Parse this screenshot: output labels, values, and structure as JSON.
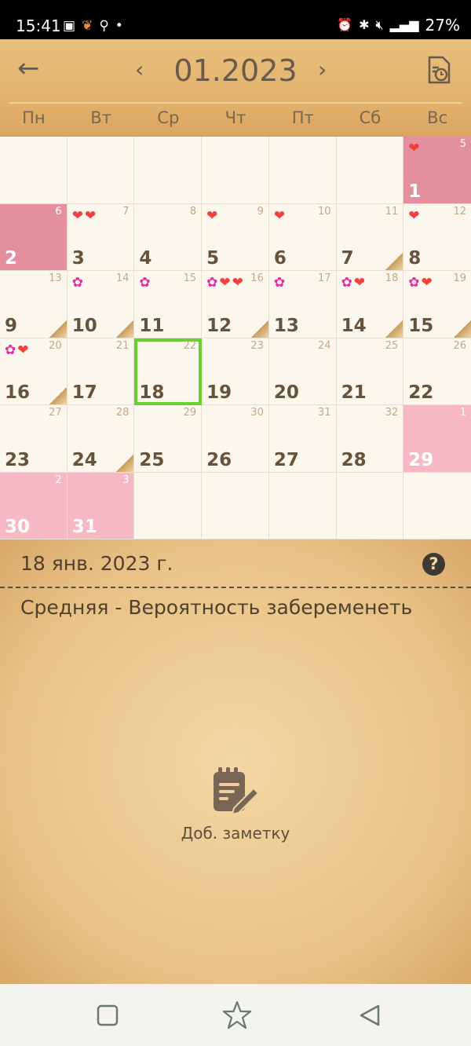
{
  "status_bar": {
    "time": "15:41",
    "left_icons": [
      "gallery-icon",
      "app-icon",
      "search-icon",
      "dot-icon"
    ],
    "right_icons": [
      "alarm-icon",
      "bluetooth-icon",
      "mute-icon",
      "volte-icon",
      "4g-icon",
      "signal-icon"
    ],
    "battery": "27%"
  },
  "header": {
    "month_title": "01.2023",
    "prev_symbol": "‹",
    "next_symbol": "›",
    "back_symbol": "←",
    "weekdays": [
      "Пн",
      "Вт",
      "Ср",
      "Чт",
      "Пт",
      "Сб",
      "Вс"
    ]
  },
  "calendar": {
    "cells": [
      {
        "day": "",
        "cycle": "",
        "state": "",
        "icons": [],
        "note": false
      },
      {
        "day": "",
        "cycle": "",
        "state": "",
        "icons": [],
        "note": false
      },
      {
        "day": "",
        "cycle": "",
        "state": "",
        "icons": [],
        "note": false
      },
      {
        "day": "",
        "cycle": "",
        "state": "",
        "icons": [],
        "note": false
      },
      {
        "day": "",
        "cycle": "",
        "state": "",
        "icons": [],
        "note": false
      },
      {
        "day": "",
        "cycle": "",
        "state": "",
        "icons": [],
        "note": false
      },
      {
        "day": "1",
        "cycle": "5",
        "state": "period-dark",
        "icons": [
          "heart"
        ],
        "note": false
      },
      {
        "day": "2",
        "cycle": "6",
        "state": "period-dark",
        "icons": [],
        "note": false
      },
      {
        "day": "3",
        "cycle": "7",
        "state": "",
        "icons": [
          "heart",
          "pill"
        ],
        "note": false
      },
      {
        "day": "4",
        "cycle": "8",
        "state": "",
        "icons": [],
        "note": false
      },
      {
        "day": "5",
        "cycle": "9",
        "state": "",
        "icons": [
          "heart"
        ],
        "note": false
      },
      {
        "day": "6",
        "cycle": "10",
        "state": "",
        "icons": [
          "heart"
        ],
        "note": false
      },
      {
        "day": "7",
        "cycle": "11",
        "state": "",
        "icons": [],
        "note": true
      },
      {
        "day": "8",
        "cycle": "12",
        "state": "",
        "icons": [
          "heart"
        ],
        "note": false
      },
      {
        "day": "9",
        "cycle": "13",
        "state": "",
        "icons": [],
        "note": true
      },
      {
        "day": "10",
        "cycle": "14",
        "state": "",
        "icons": [
          "flower"
        ],
        "note": true
      },
      {
        "day": "11",
        "cycle": "15",
        "state": "",
        "icons": [
          "flower"
        ],
        "note": false
      },
      {
        "day": "12",
        "cycle": "16",
        "state": "",
        "icons": [
          "flower",
          "heart",
          "pill"
        ],
        "note": true
      },
      {
        "day": "13",
        "cycle": "17",
        "state": "",
        "icons": [
          "flower"
        ],
        "note": false
      },
      {
        "day": "14",
        "cycle": "18",
        "state": "",
        "icons": [
          "flower",
          "heart"
        ],
        "note": true
      },
      {
        "day": "15",
        "cycle": "19",
        "state": "",
        "icons": [
          "flower",
          "heart"
        ],
        "note": true
      },
      {
        "day": "16",
        "cycle": "20",
        "state": "",
        "icons": [
          "flower",
          "heart"
        ],
        "note": true
      },
      {
        "day": "17",
        "cycle": "21",
        "state": "",
        "icons": [],
        "note": false
      },
      {
        "day": "18",
        "cycle": "22",
        "state": "today",
        "icons": [],
        "note": false
      },
      {
        "day": "19",
        "cycle": "23",
        "state": "",
        "icons": [],
        "note": false
      },
      {
        "day": "20",
        "cycle": "24",
        "state": "",
        "icons": [],
        "note": false
      },
      {
        "day": "21",
        "cycle": "25",
        "state": "",
        "icons": [],
        "note": false
      },
      {
        "day": "22",
        "cycle": "26",
        "state": "",
        "icons": [],
        "note": false
      },
      {
        "day": "23",
        "cycle": "27",
        "state": "",
        "icons": [],
        "note": false
      },
      {
        "day": "24",
        "cycle": "28",
        "state": "",
        "icons": [],
        "note": true
      },
      {
        "day": "25",
        "cycle": "29",
        "state": "",
        "icons": [],
        "note": false
      },
      {
        "day": "26",
        "cycle": "30",
        "state": "",
        "icons": [],
        "note": false
      },
      {
        "day": "27",
        "cycle": "31",
        "state": "",
        "icons": [],
        "note": false
      },
      {
        "day": "28",
        "cycle": "32",
        "state": "",
        "icons": [],
        "note": false
      },
      {
        "day": "29",
        "cycle": "1",
        "state": "period-light",
        "icons": [],
        "note": false
      },
      {
        "day": "30",
        "cycle": "2",
        "state": "period-light",
        "icons": [],
        "note": false
      },
      {
        "day": "31",
        "cycle": "3",
        "state": "period-light",
        "icons": [],
        "note": false
      },
      {
        "day": "",
        "cycle": "",
        "state": "",
        "icons": [],
        "note": false
      },
      {
        "day": "",
        "cycle": "",
        "state": "",
        "icons": [],
        "note": false
      },
      {
        "day": "",
        "cycle": "",
        "state": "",
        "icons": [],
        "note": false
      },
      {
        "day": "",
        "cycle": "",
        "state": "",
        "icons": [],
        "note": false
      },
      {
        "day": "",
        "cycle": "",
        "state": "",
        "icons": [],
        "note": false
      }
    ]
  },
  "details": {
    "date": "18 янв. 2023 г.",
    "help": "?",
    "fertility": "Средняя - Вероятность забеременеть",
    "add_note_label": "Доб. заметку"
  },
  "colors": {
    "period_dark": "#e48f9e",
    "period_light": "#f6b8c5",
    "today_outline": "#67d12d",
    "header_bg": "#e3b46f"
  }
}
